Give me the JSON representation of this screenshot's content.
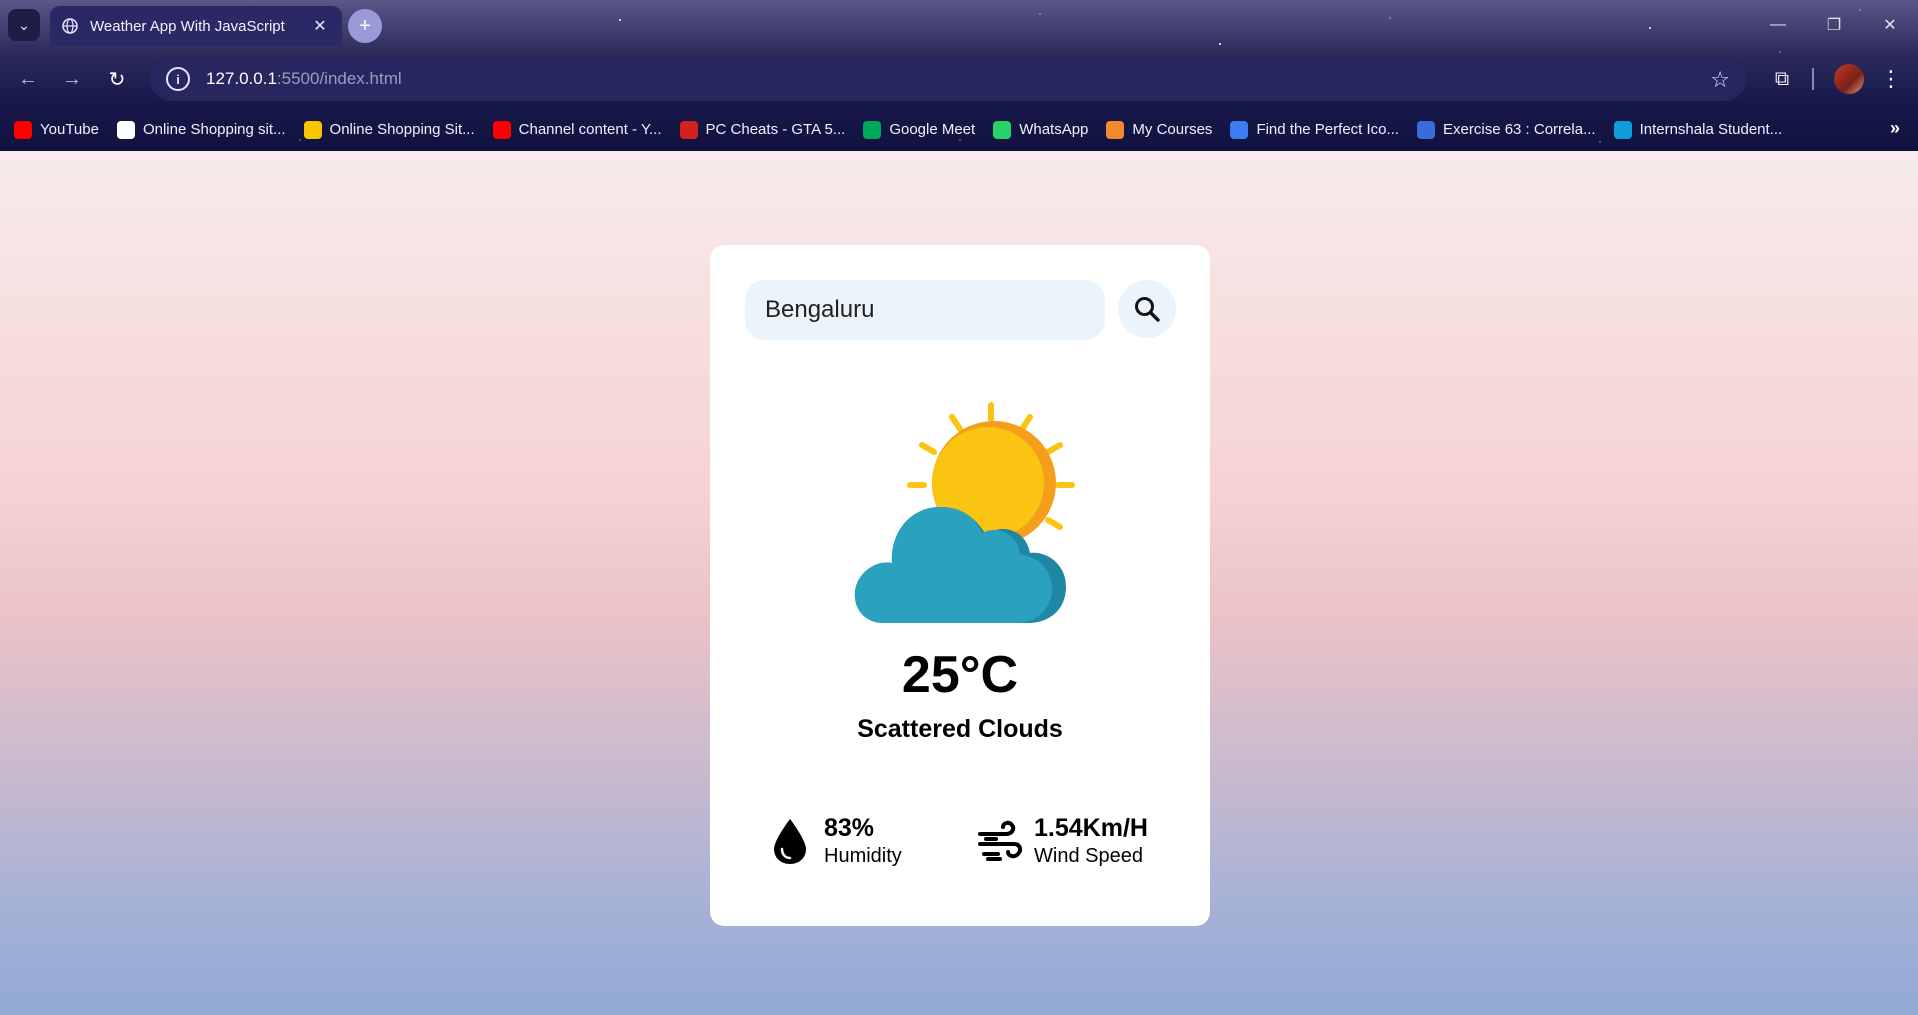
{
  "browser": {
    "tab_title": "Weather App With JavaScript",
    "url_host": "127.0.0.1",
    "url_path": ":5500/index.html",
    "bookmarks": [
      {
        "label": "YouTube",
        "icon": "youtube-icon",
        "color": "#ff0000"
      },
      {
        "label": "Online Shopping sit...",
        "icon": "amazon-icon",
        "color": "#ffffff"
      },
      {
        "label": "Online Shopping Sit...",
        "icon": "flipkart-icon",
        "color": "#f7c600"
      },
      {
        "label": "Channel content - Y...",
        "icon": "youtube-studio-icon",
        "color": "#ff0000"
      },
      {
        "label": "PC Cheats - GTA 5...",
        "icon": "gta-icon",
        "color": "#d32020"
      },
      {
        "label": "Google Meet",
        "icon": "google-meet-icon",
        "color": "#00a85a"
      },
      {
        "label": "WhatsApp",
        "icon": "whatsapp-icon",
        "color": "#25d366"
      },
      {
        "label": "My Courses",
        "icon": "courses-icon",
        "color": "#f08a2a"
      },
      {
        "label": "Find the Perfect Ico...",
        "icon": "flag-icon",
        "color": "#3d7bf0"
      },
      {
        "label": "Exercise 63 : Correla...",
        "icon": "exercise-icon",
        "color": "#3a6bd8"
      },
      {
        "label": "Internshala Student...",
        "icon": "internshala-icon",
        "color": "#0e9cd8"
      }
    ]
  },
  "weather": {
    "city_value": "Bengaluru",
    "temperature": "25°C",
    "description": "Scattered Clouds",
    "humidity_value": "83%",
    "humidity_label": "Humidity",
    "wind_value": "1.54Km/H",
    "wind_label": "Wind Speed",
    "condition_icon": "sun-behind-cloud-icon"
  },
  "colors": {
    "sun": "#fbc312",
    "sun_shade": "#f59e1a",
    "cloud": "#2aa1bf",
    "cloud_shade": "#1f86a3",
    "card_bg": "#ffffff",
    "input_bg": "#ebf4fa"
  }
}
